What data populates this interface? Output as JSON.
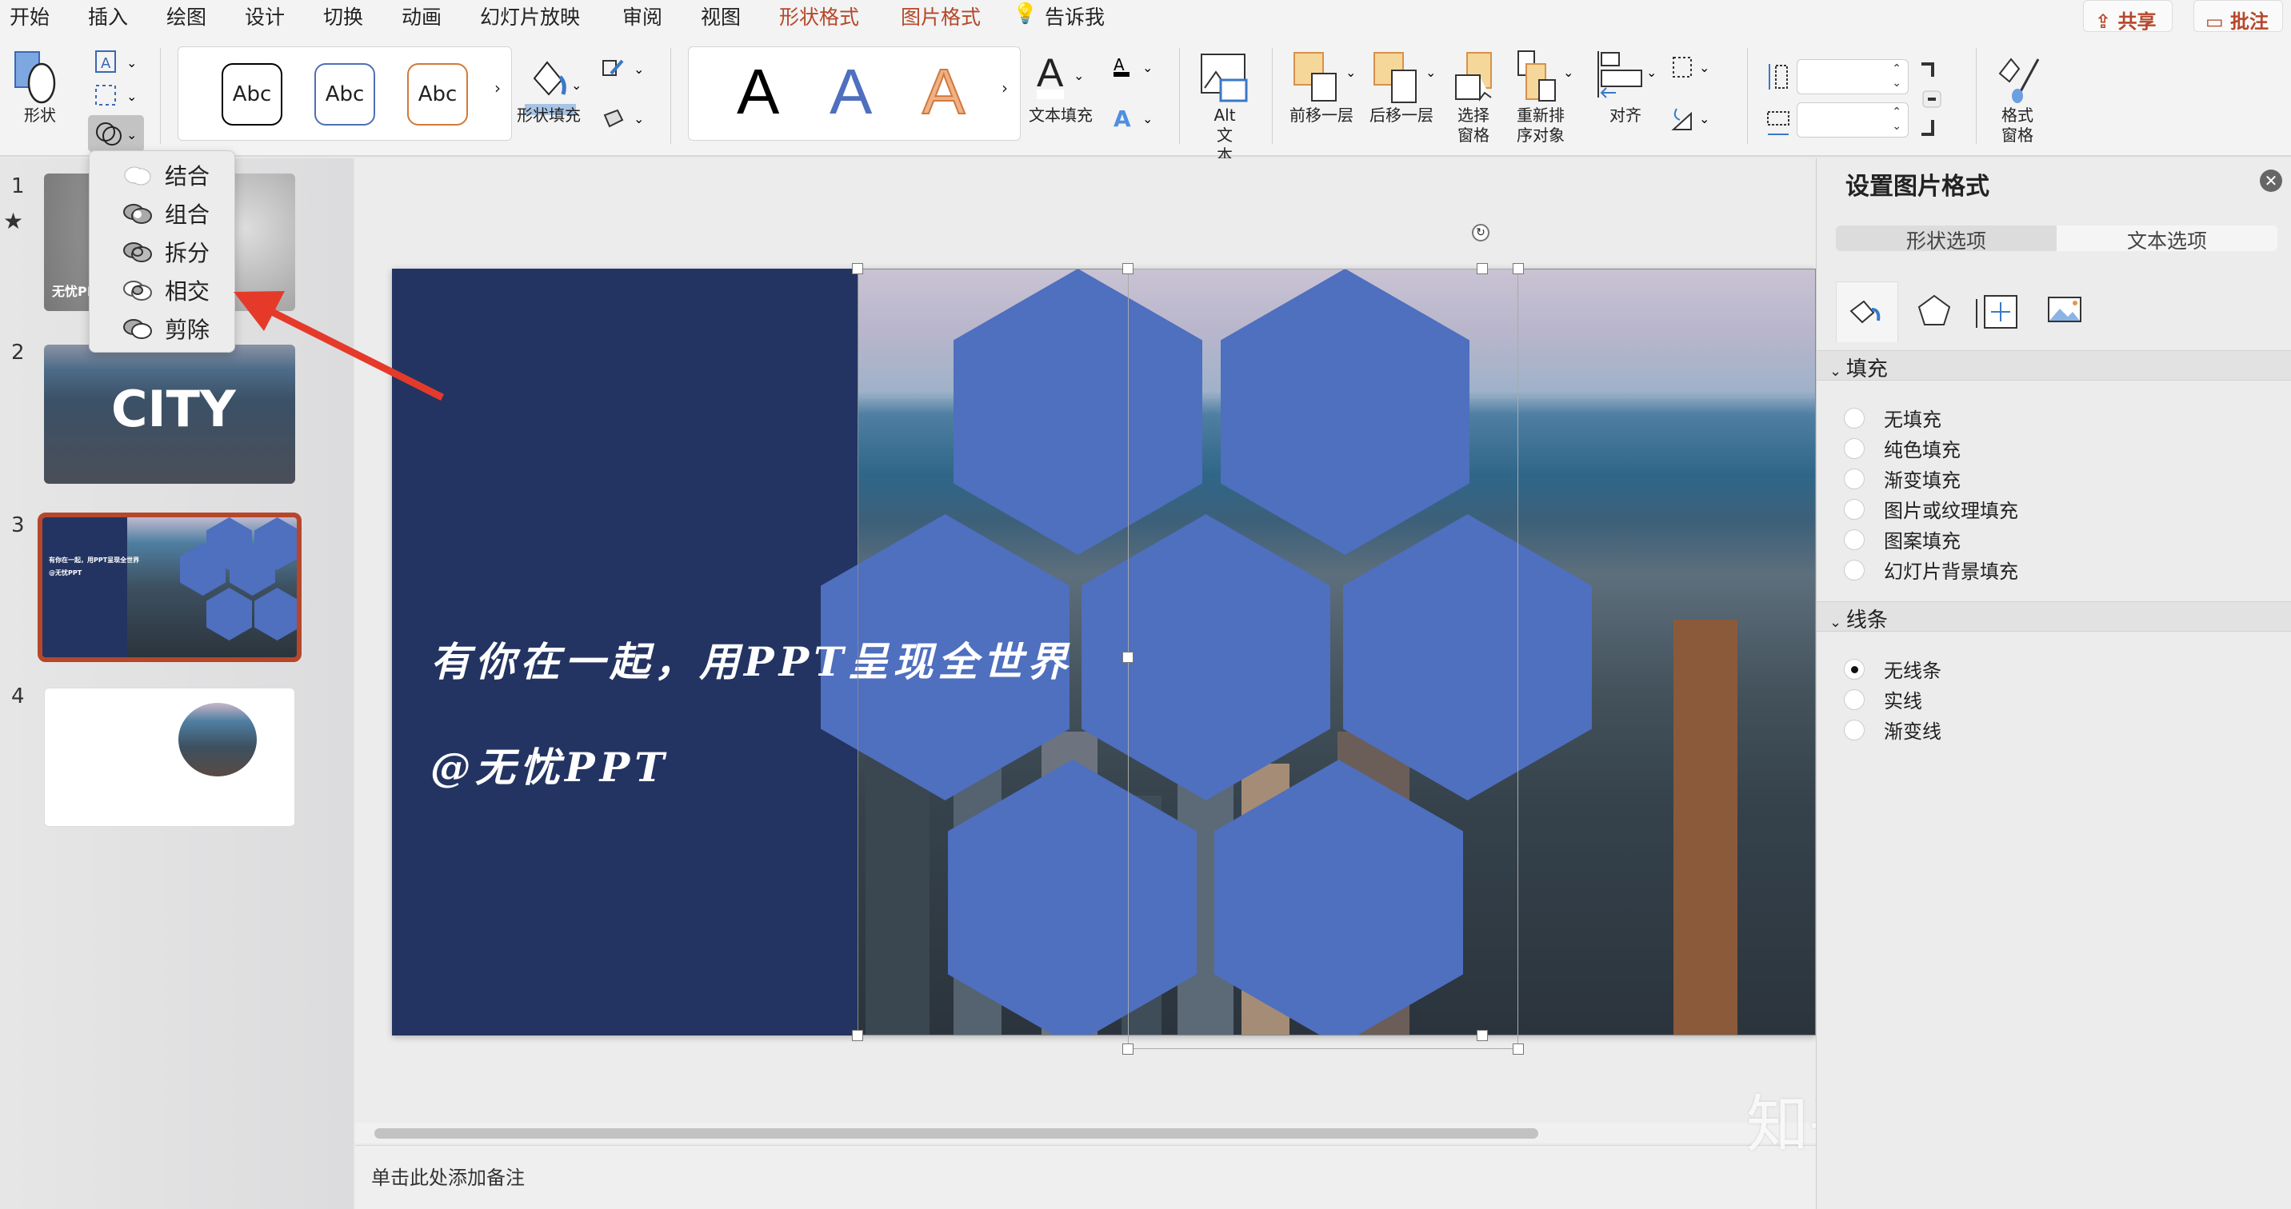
{
  "menu": {
    "tabs": [
      "开始",
      "插入",
      "绘图",
      "设计",
      "切换",
      "动画",
      "幻灯片放映",
      "审阅",
      "视图",
      "形状格式",
      "图片格式",
      "告诉我"
    ],
    "active": "形状格式",
    "share": "共享",
    "comment": "批注"
  },
  "ribbon": {
    "shape": "形状",
    "shape_fill": "形状填充",
    "text_fill": "文本填充",
    "alt_text": "Alt\n文本",
    "alt_1": "Alt",
    "alt_2": "文本",
    "bring_forward": "前移一层",
    "send_backward": "后移一层",
    "selection_pane_1": "选择",
    "selection_pane_2": "窗格",
    "reorder_1": "重新排",
    "reorder_2": "序对象",
    "align": "对齐",
    "format_pane_1": "格式",
    "format_pane_2": "窗格",
    "style_samples": [
      "Abc",
      "Abc",
      "Abc"
    ],
    "wordart_samples": [
      "A",
      "A",
      "A"
    ],
    "height_value": "",
    "width_value": ""
  },
  "merge_menu": {
    "items": [
      "结合",
      "组合",
      "拆分",
      "相交",
      "剪除"
    ],
    "highlighted": "相交"
  },
  "slides": {
    "numbers": [
      "1",
      "2",
      "3",
      "4"
    ],
    "selected": 3,
    "thumb1_text": "无忧PPT",
    "thumb2_text": "CITY",
    "thumb3_line1": "有你在一起，用PPT呈现全世界",
    "thumb3_line2": "@无忧PPT"
  },
  "slide": {
    "line1": "有你在一起，用PPT呈现全世界",
    "line2": "@无忧PPT",
    "hex_color": "#4f6fbf",
    "bg_color": "#233462"
  },
  "notes_placeholder": "单击此处添加备注",
  "watermark": "知乎 @无忧PPT",
  "format_pane": {
    "title": "设置图片格式",
    "tabs": [
      "形状选项",
      "文本选项"
    ],
    "fill_header": "填充",
    "fill_options": [
      "无填充",
      "纯色填充",
      "渐变填充",
      "图片或纹理填充",
      "图案填充",
      "幻灯片背景填充"
    ],
    "line_header": "线条",
    "line_options": [
      "无线条",
      "实线",
      "渐变线"
    ],
    "line_selected": "无线条"
  },
  "colors": {
    "accent": "#b6472a",
    "arrow": "#e53a2a"
  }
}
